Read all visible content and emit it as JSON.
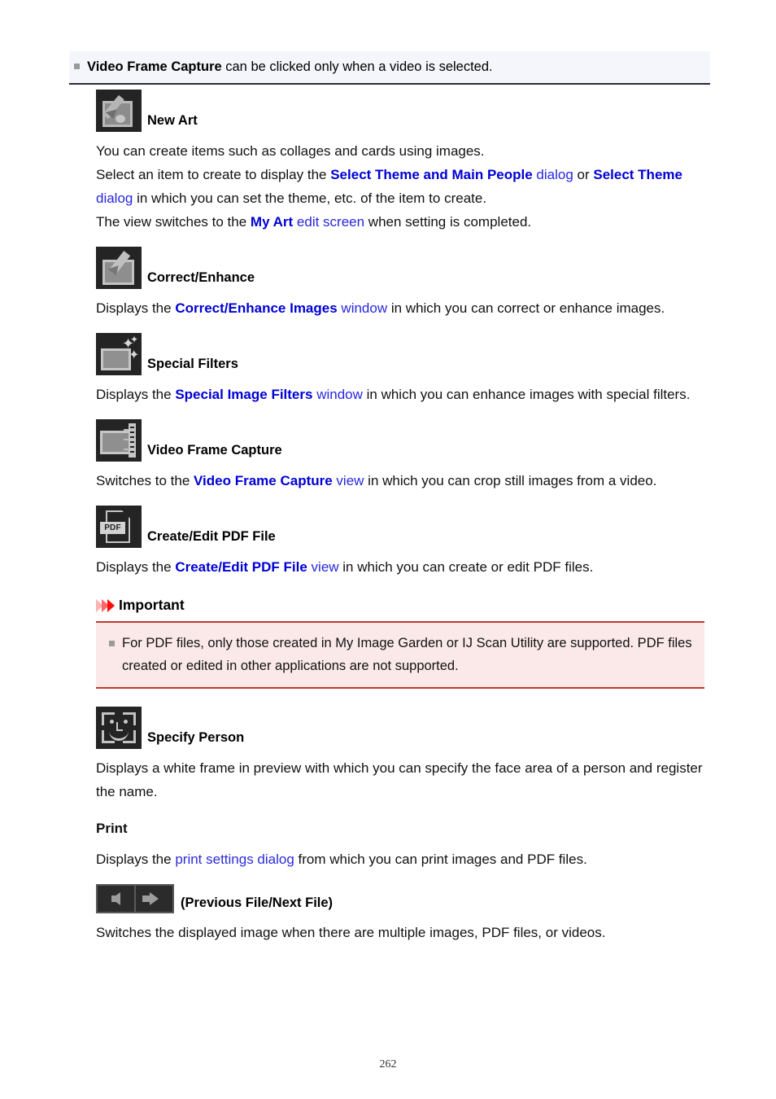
{
  "page": {
    "number": "262"
  },
  "note": {
    "bullet_icon": "square-bullet-icon",
    "bold_term": "Video Frame Capture",
    "rest": " can be clicked only when a video is selected."
  },
  "sections": [
    {
      "id": "new-art",
      "icon_name": "new-art-icon",
      "caption": "New Art",
      "paragraphs": [
        {
          "runs": [
            {
              "text": "You can create items such as collages and cards using images.",
              "style": "plain"
            }
          ]
        },
        {
          "runs": [
            {
              "text": "Select an item to create to display the ",
              "style": "plain"
            },
            {
              "text": "Select Theme and Main People",
              "style": "link-bold"
            },
            {
              "text": " dialog",
              "style": "link-plain"
            },
            {
              "text": " or ",
              "style": "plain"
            },
            {
              "text": "Select Theme",
              "style": "link-bold"
            },
            {
              "text": " dialog",
              "style": "link-plain"
            },
            {
              "text": " in which you can set the theme, etc. of the item to create.",
              "style": "plain"
            }
          ]
        },
        {
          "runs": [
            {
              "text": "The view switches to the ",
              "style": "plain"
            },
            {
              "text": "My Art",
              "style": "link-bold"
            },
            {
              "text": " edit screen",
              "style": "link-plain"
            },
            {
              "text": " when setting is completed.",
              "style": "plain"
            }
          ]
        }
      ]
    },
    {
      "id": "correct-enhance",
      "icon_name": "correct-enhance-icon",
      "caption": "Correct/Enhance",
      "paragraphs": [
        {
          "runs": [
            {
              "text": "Displays the ",
              "style": "plain"
            },
            {
              "text": "Correct/Enhance Images",
              "style": "link-bold"
            },
            {
              "text": " window",
              "style": "link-plain"
            },
            {
              "text": " in which you can correct or enhance images.",
              "style": "plain"
            }
          ]
        }
      ]
    },
    {
      "id": "special-filters",
      "icon_name": "special-filters-icon",
      "caption": "Special Filters",
      "paragraphs": [
        {
          "runs": [
            {
              "text": "Displays the ",
              "style": "plain"
            },
            {
              "text": "Special Image Filters",
              "style": "link-bold"
            },
            {
              "text": " window",
              "style": "link-plain"
            },
            {
              "text": " in which you can enhance images with special filters.",
              "style": "plain"
            }
          ]
        }
      ]
    },
    {
      "id": "video-frame-capture",
      "icon_name": "video-frame-capture-icon",
      "caption": "Video Frame Capture",
      "paragraphs": [
        {
          "runs": [
            {
              "text": "Switches to the ",
              "style": "plain"
            },
            {
              "text": "Video Frame Capture",
              "style": "link-bold"
            },
            {
              "text": " view",
              "style": "link-plain"
            },
            {
              "text": " in which you can crop still images from a video.",
              "style": "plain"
            }
          ]
        }
      ]
    },
    {
      "id": "create-edit-pdf",
      "icon_name": "create-edit-pdf-icon",
      "caption": "Create/Edit PDF File",
      "icon_label": "PDF",
      "paragraphs": [
        {
          "runs": [
            {
              "text": "Displays the ",
              "style": "plain"
            },
            {
              "text": "Create/Edit PDF File",
              "style": "link-bold"
            },
            {
              "text": " view",
              "style": "link-plain"
            },
            {
              "text": " in which you can create or edit PDF files.",
              "style": "plain"
            }
          ]
        }
      ]
    },
    {
      "id": "specify-person",
      "icon_name": "specify-person-icon",
      "caption": "Specify Person",
      "paragraphs": [
        {
          "runs": [
            {
              "text": "Displays a white frame in preview with which you can specify the face area of a person and register the name.",
              "style": "plain"
            }
          ]
        }
      ]
    }
  ],
  "important": {
    "title": "Important",
    "chevron_icon": "triple-chevron-icon",
    "bullet_icon": "square-bullet-icon",
    "body": "For PDF files, only those created in My Image Garden or IJ Scan Utility are supported. PDF files created or edited in other applications are not supported."
  },
  "print": {
    "heading": "Print",
    "paragraph": {
      "runs": [
        {
          "text": "Displays the ",
          "style": "plain"
        },
        {
          "text": "print settings dialog",
          "style": "link-soft"
        },
        {
          "text": " from which you can print images and PDF files.",
          "style": "plain"
        }
      ]
    }
  },
  "file_nav": {
    "prev_icon": "previous-file-arrow-icon",
    "next_icon": "next-file-arrow-icon",
    "caption": "(Previous File/Next File)",
    "paragraph": "Switches the displayed image when there are multiple images, PDF files, or videos."
  },
  "colors": {
    "link_bold": "#0000d6",
    "link_plain": "#2727e0",
    "note_bg": "#f4f6fb",
    "important_bg": "#fbe9e9",
    "important_border": "#c0392b",
    "icon_bg": "#242424"
  }
}
